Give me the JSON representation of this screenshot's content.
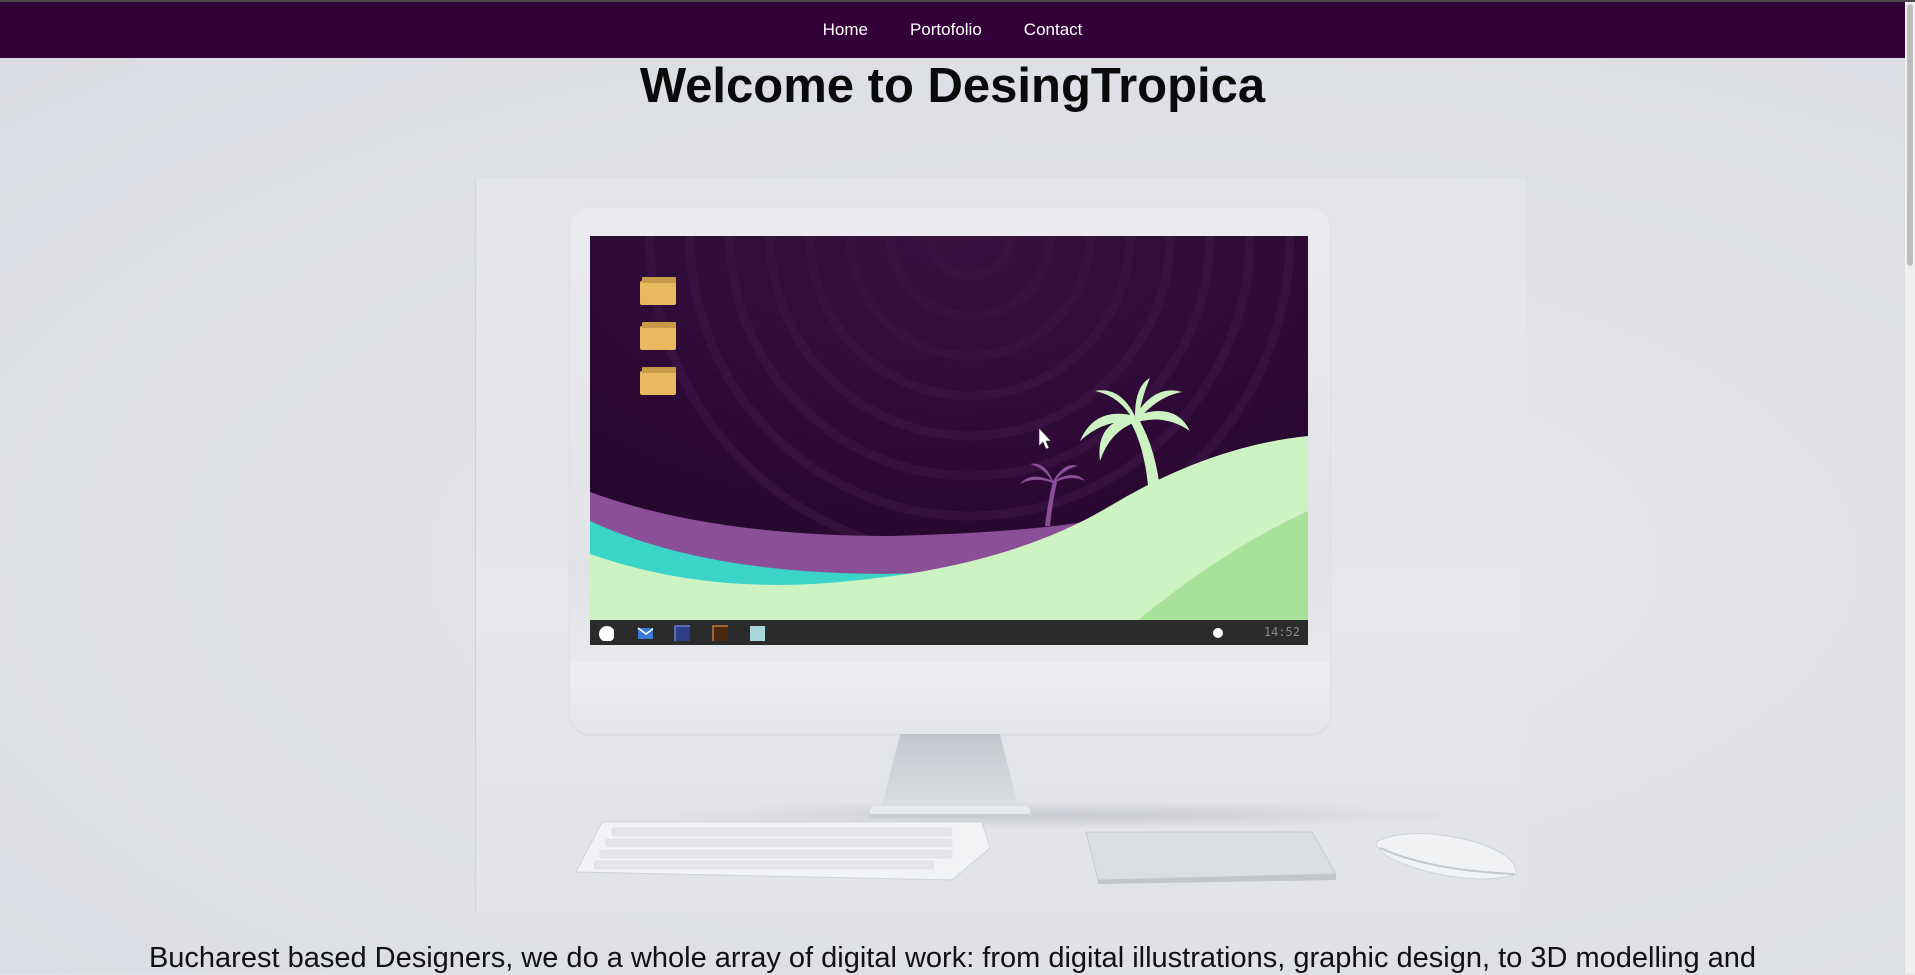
{
  "nav": {
    "items": [
      "Home",
      "Portofolio",
      "Contact"
    ]
  },
  "heading": "Welcome to DesingTropica",
  "hero_screen": {
    "clock": "14:52"
  },
  "tagline": "Bucharest based Designers, we do a whole array of digital work: from digital illustrations, graphic design, to 3D modelling and",
  "colors": {
    "navbar": "#33003a",
    "page_background": "#dfe1e6",
    "wallpaper_purple": "#2a0a33",
    "accent_teal": "#3bd4c8",
    "accent_green": "#cdf3c2",
    "accent_mauve": "#8a4f96"
  },
  "icons": [
    "folder-icon",
    "palm-tree-icon",
    "mouse-cursor-icon",
    "mail-icon",
    "start-button-icon"
  ]
}
